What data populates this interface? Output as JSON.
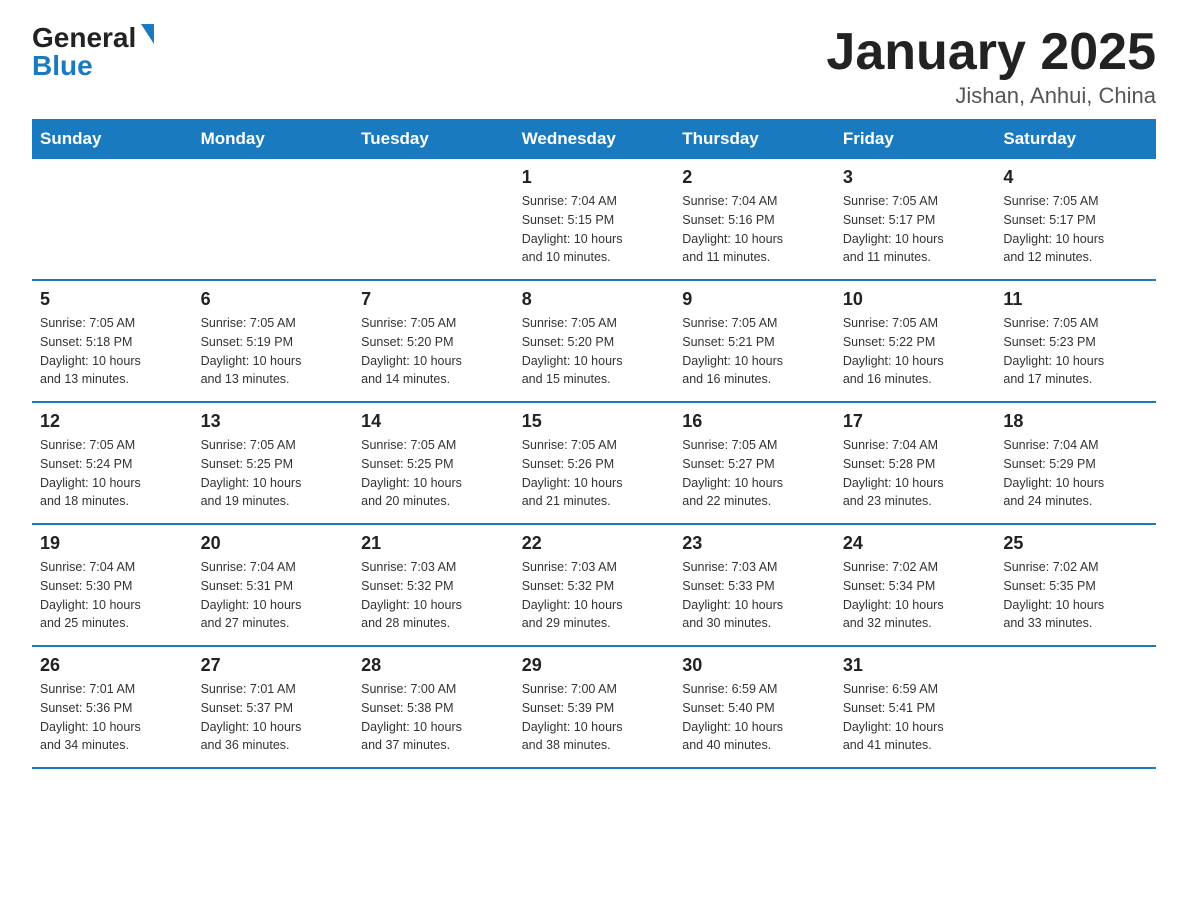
{
  "logo": {
    "general": "General",
    "blue": "Blue",
    "triangle": "▲"
  },
  "title": "January 2025",
  "subtitle": "Jishan, Anhui, China",
  "headers": [
    "Sunday",
    "Monday",
    "Tuesday",
    "Wednesday",
    "Thursday",
    "Friday",
    "Saturday"
  ],
  "weeks": [
    [
      {
        "day": "",
        "info": ""
      },
      {
        "day": "",
        "info": ""
      },
      {
        "day": "",
        "info": ""
      },
      {
        "day": "1",
        "info": "Sunrise: 7:04 AM\nSunset: 5:15 PM\nDaylight: 10 hours\nand 10 minutes."
      },
      {
        "day": "2",
        "info": "Sunrise: 7:04 AM\nSunset: 5:16 PM\nDaylight: 10 hours\nand 11 minutes."
      },
      {
        "day": "3",
        "info": "Sunrise: 7:05 AM\nSunset: 5:17 PM\nDaylight: 10 hours\nand 11 minutes."
      },
      {
        "day": "4",
        "info": "Sunrise: 7:05 AM\nSunset: 5:17 PM\nDaylight: 10 hours\nand 12 minutes."
      }
    ],
    [
      {
        "day": "5",
        "info": "Sunrise: 7:05 AM\nSunset: 5:18 PM\nDaylight: 10 hours\nand 13 minutes."
      },
      {
        "day": "6",
        "info": "Sunrise: 7:05 AM\nSunset: 5:19 PM\nDaylight: 10 hours\nand 13 minutes."
      },
      {
        "day": "7",
        "info": "Sunrise: 7:05 AM\nSunset: 5:20 PM\nDaylight: 10 hours\nand 14 minutes."
      },
      {
        "day": "8",
        "info": "Sunrise: 7:05 AM\nSunset: 5:20 PM\nDaylight: 10 hours\nand 15 minutes."
      },
      {
        "day": "9",
        "info": "Sunrise: 7:05 AM\nSunset: 5:21 PM\nDaylight: 10 hours\nand 16 minutes."
      },
      {
        "day": "10",
        "info": "Sunrise: 7:05 AM\nSunset: 5:22 PM\nDaylight: 10 hours\nand 16 minutes."
      },
      {
        "day": "11",
        "info": "Sunrise: 7:05 AM\nSunset: 5:23 PM\nDaylight: 10 hours\nand 17 minutes."
      }
    ],
    [
      {
        "day": "12",
        "info": "Sunrise: 7:05 AM\nSunset: 5:24 PM\nDaylight: 10 hours\nand 18 minutes."
      },
      {
        "day": "13",
        "info": "Sunrise: 7:05 AM\nSunset: 5:25 PM\nDaylight: 10 hours\nand 19 minutes."
      },
      {
        "day": "14",
        "info": "Sunrise: 7:05 AM\nSunset: 5:25 PM\nDaylight: 10 hours\nand 20 minutes."
      },
      {
        "day": "15",
        "info": "Sunrise: 7:05 AM\nSunset: 5:26 PM\nDaylight: 10 hours\nand 21 minutes."
      },
      {
        "day": "16",
        "info": "Sunrise: 7:05 AM\nSunset: 5:27 PM\nDaylight: 10 hours\nand 22 minutes."
      },
      {
        "day": "17",
        "info": "Sunrise: 7:04 AM\nSunset: 5:28 PM\nDaylight: 10 hours\nand 23 minutes."
      },
      {
        "day": "18",
        "info": "Sunrise: 7:04 AM\nSunset: 5:29 PM\nDaylight: 10 hours\nand 24 minutes."
      }
    ],
    [
      {
        "day": "19",
        "info": "Sunrise: 7:04 AM\nSunset: 5:30 PM\nDaylight: 10 hours\nand 25 minutes."
      },
      {
        "day": "20",
        "info": "Sunrise: 7:04 AM\nSunset: 5:31 PM\nDaylight: 10 hours\nand 27 minutes."
      },
      {
        "day": "21",
        "info": "Sunrise: 7:03 AM\nSunset: 5:32 PM\nDaylight: 10 hours\nand 28 minutes."
      },
      {
        "day": "22",
        "info": "Sunrise: 7:03 AM\nSunset: 5:32 PM\nDaylight: 10 hours\nand 29 minutes."
      },
      {
        "day": "23",
        "info": "Sunrise: 7:03 AM\nSunset: 5:33 PM\nDaylight: 10 hours\nand 30 minutes."
      },
      {
        "day": "24",
        "info": "Sunrise: 7:02 AM\nSunset: 5:34 PM\nDaylight: 10 hours\nand 32 minutes."
      },
      {
        "day": "25",
        "info": "Sunrise: 7:02 AM\nSunset: 5:35 PM\nDaylight: 10 hours\nand 33 minutes."
      }
    ],
    [
      {
        "day": "26",
        "info": "Sunrise: 7:01 AM\nSunset: 5:36 PM\nDaylight: 10 hours\nand 34 minutes."
      },
      {
        "day": "27",
        "info": "Sunrise: 7:01 AM\nSunset: 5:37 PM\nDaylight: 10 hours\nand 36 minutes."
      },
      {
        "day": "28",
        "info": "Sunrise: 7:00 AM\nSunset: 5:38 PM\nDaylight: 10 hours\nand 37 minutes."
      },
      {
        "day": "29",
        "info": "Sunrise: 7:00 AM\nSunset: 5:39 PM\nDaylight: 10 hours\nand 38 minutes."
      },
      {
        "day": "30",
        "info": "Sunrise: 6:59 AM\nSunset: 5:40 PM\nDaylight: 10 hours\nand 40 minutes."
      },
      {
        "day": "31",
        "info": "Sunrise: 6:59 AM\nSunset: 5:41 PM\nDaylight: 10 hours\nand 41 minutes."
      },
      {
        "day": "",
        "info": ""
      }
    ]
  ]
}
